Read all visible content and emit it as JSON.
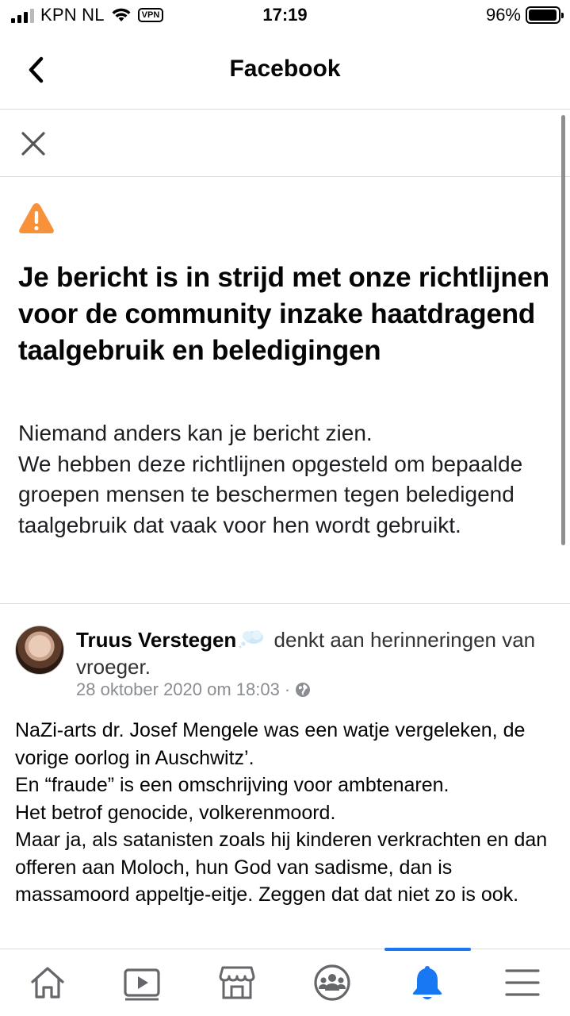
{
  "status_bar": {
    "carrier": "KPN NL",
    "vpn_label": "VPN",
    "time": "17:19",
    "battery_percent": "96%",
    "battery_level": 0.96
  },
  "header": {
    "title": "Facebook",
    "back_icon": "chevron-left-icon"
  },
  "notice": {
    "close_icon": "close-icon",
    "warning_icon": "warning-triangle-icon",
    "warning_color": "#f7923a",
    "title": "Je bericht is in strijd met onze richtlijnen voor de community inzake haatdragend taalgebruik en beledigingen",
    "body_lines": [
      "Niemand anders kan je bericht zien.",
      "We hebben deze richtlijnen opgesteld om bepaalde groepen mensen te beschermen tegen beledigend taalgebruik dat vaak voor hen wordt gebruikt."
    ]
  },
  "post": {
    "author": "Truus Verstegen",
    "feeling_icon": "thought-bubble-icon",
    "activity": "denkt aan herinneringen van vroeger.",
    "timestamp": "28 oktober 2020 om 18:03",
    "separator": "·",
    "privacy_icon": "globe-icon",
    "body": [
      "NaZi-arts dr. Josef Mengele was een watje vergeleken, de vorige oorlog in Auschwitz’.",
      "En “fraude” is een omschrijving voor ambtenaren.",
      "Het betrof genocide, volkerenmoord.",
      "Maar ja, als satanisten zoals hij kinderen verkrachten en dan offeren aan Moloch, hun God van sadisme, dan is massamoord appeltje-eitje. Zeggen dat dat niet zo is ook."
    ]
  },
  "tab_bar": {
    "tabs": [
      {
        "icon": "home-icon"
      },
      {
        "icon": "video-icon"
      },
      {
        "icon": "marketplace-icon"
      },
      {
        "icon": "groups-icon"
      },
      {
        "icon": "notifications-bell-icon",
        "active": true
      },
      {
        "icon": "menu-icon"
      }
    ],
    "active_color": "#1877f2"
  }
}
